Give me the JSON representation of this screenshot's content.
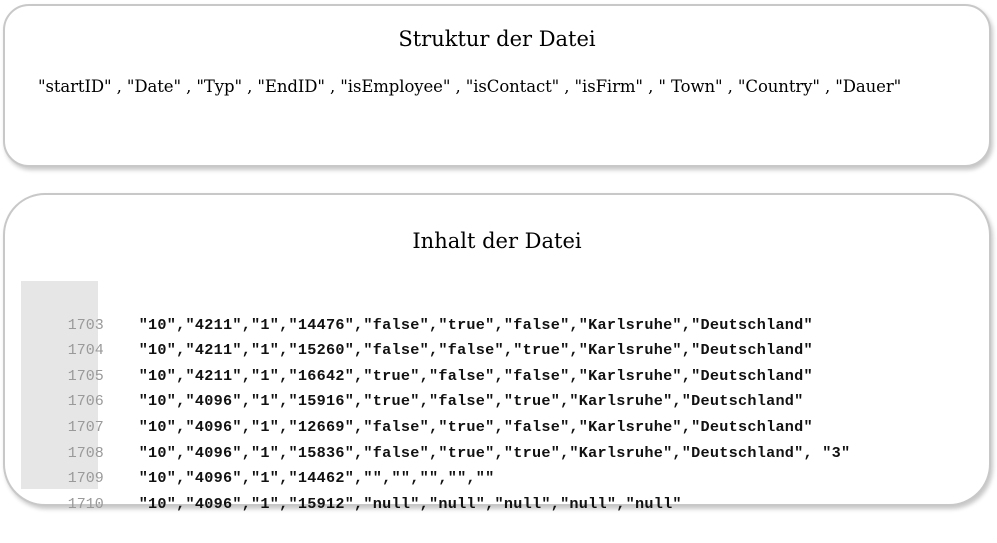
{
  "structure": {
    "title": "Struktur der Datei",
    "fields": "\"startID\" , \"Date\" , \"Typ\" , \"EndID\" , \"isEmployee\" , \"isContact\" , \"isFirm\" , \" Town\" , \"Country\" , \"Dauer\""
  },
  "content": {
    "title": "Inhalt der Datei",
    "lines": [
      {
        "number": "1703",
        "text": "\"10\",\"4211\",\"1\",\"14476\",\"false\",\"true\",\"false\",\"Karlsruhe\",\"Deutschland\""
      },
      {
        "number": "1704",
        "text": "\"10\",\"4211\",\"1\",\"15260\",\"false\",\"false\",\"true\",\"Karlsruhe\",\"Deutschland\""
      },
      {
        "number": "1705",
        "text": "\"10\",\"4211\",\"1\",\"16642\",\"true\",\"false\",\"false\",\"Karlsruhe\",\"Deutschland\""
      },
      {
        "number": "1706",
        "text": "\"10\",\"4096\",\"1\",\"15916\",\"true\",\"false\",\"true\",\"Karlsruhe\",\"Deutschland\""
      },
      {
        "number": "1707",
        "text": "\"10\",\"4096\",\"1\",\"12669\",\"false\",\"true\",\"false\",\"Karlsruhe\",\"Deutschland\""
      },
      {
        "number": "1708",
        "text": "\"10\",\"4096\",\"1\",\"15836\",\"false\",\"true\",\"true\",\"Karlsruhe\",\"Deutschland\", \"3\""
      },
      {
        "number": "1709",
        "text": "\"10\",\"4096\",\"1\",\"14462\",\"\",\"\",\"\",\"\",\"\""
      },
      {
        "number": "1710",
        "text": "\"10\",\"4096\",\"1\",\"15912\",\"null\",\"null\",\"null\",\"null\",\"null\""
      }
    ]
  }
}
